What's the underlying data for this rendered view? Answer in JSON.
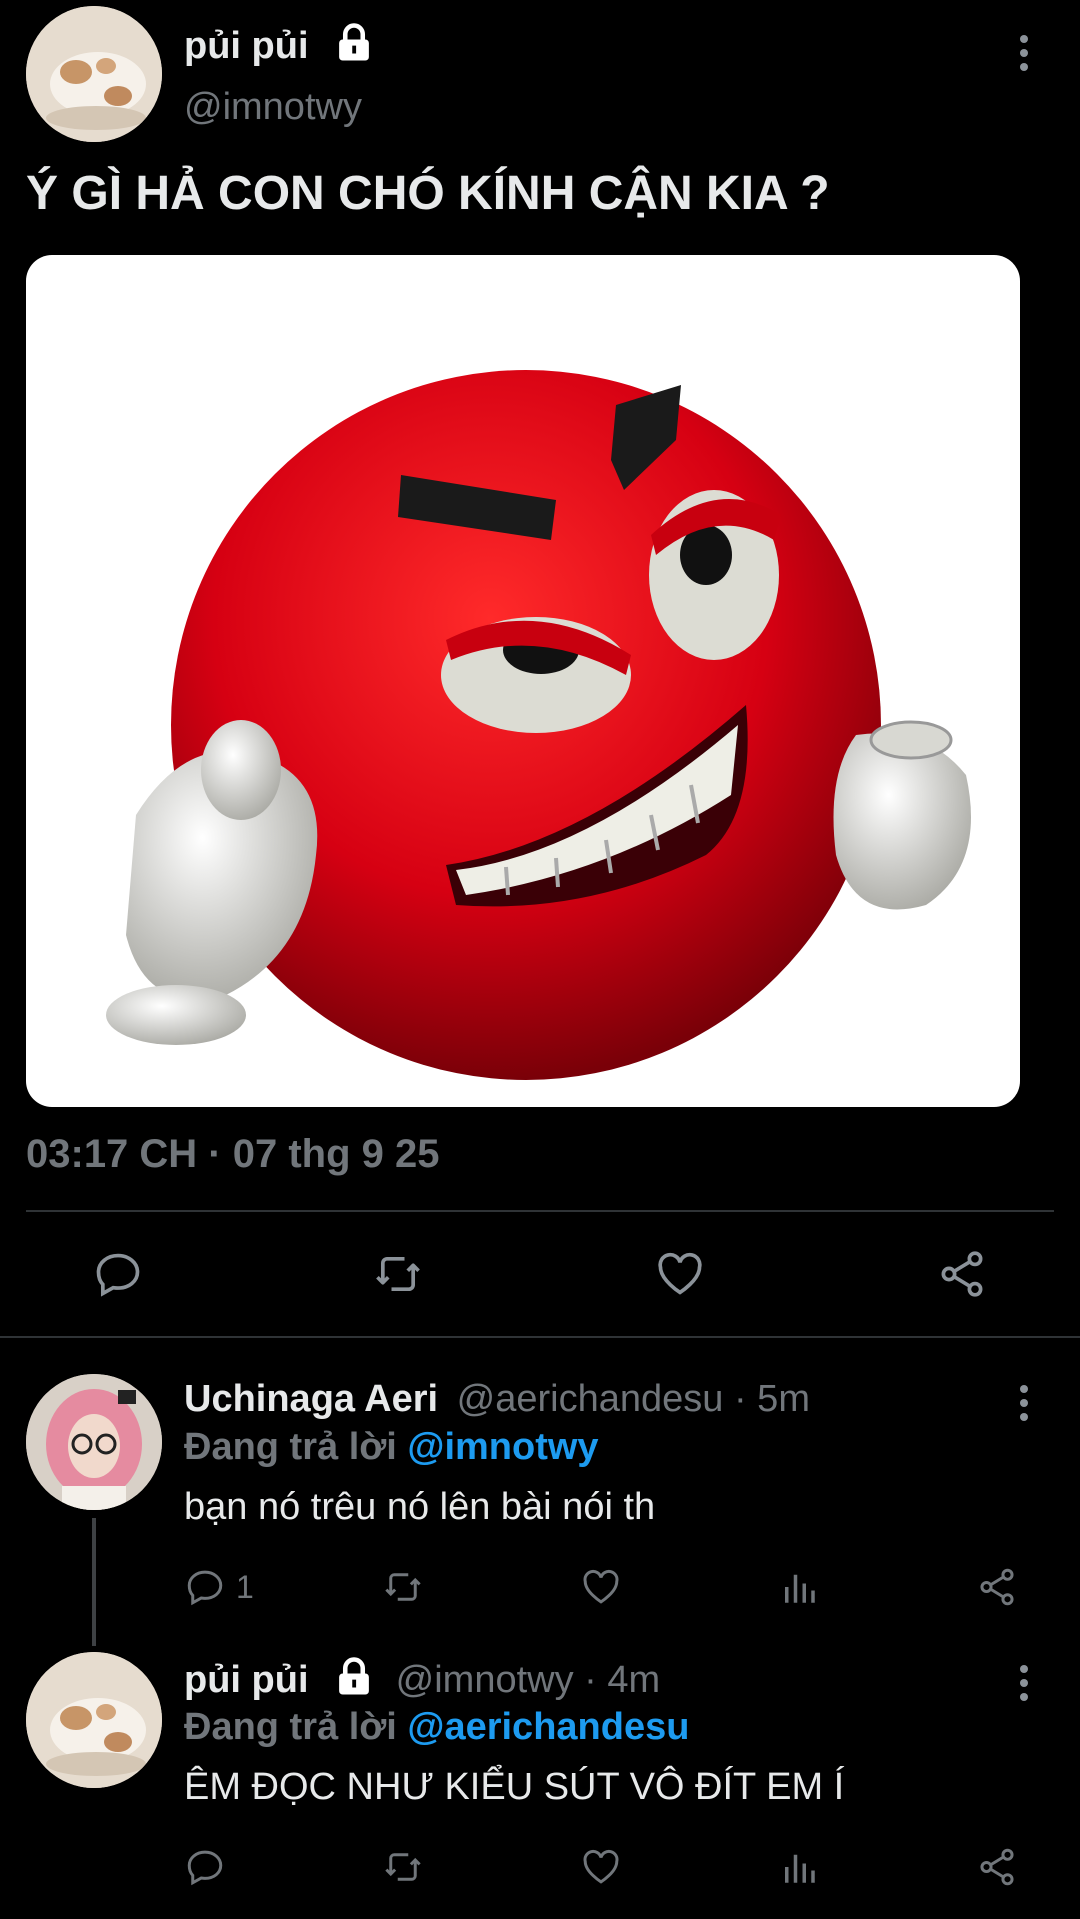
{
  "main_tweet": {
    "display_name": "pủi pủi",
    "handle": "@imnotwy",
    "text": "Ý GÌ HẢ CON CHÓ KÍNH CẬN KIA ?",
    "timestamp": "03:17 CH · 07 thg 9 25",
    "image_icon": "angry-red-emoji-image"
  },
  "replies": [
    {
      "display_name": "Uchinaga Aeri",
      "meta": "@aerichandesu · 5m",
      "replying_prefix": "Đang trả lời ",
      "replying_to": "@imnotwy",
      "text": "bạn nó trêu nó lên bài nói th",
      "reply_count": "1"
    },
    {
      "display_name": "pủi pủi",
      "meta": "@imnotwy · 4m",
      "replying_prefix": "Đang trả lời ",
      "replying_to": "@aerichandesu",
      "text": "ÊM ĐỌC NHƯ KIỂU SÚT VÔ ĐÍT EM Í"
    }
  ],
  "colors": {
    "background": "#000000",
    "text": "#e7e9ea",
    "secondary": "#71767b",
    "accent": "#1d9bf0",
    "divider": "#2f3336"
  }
}
